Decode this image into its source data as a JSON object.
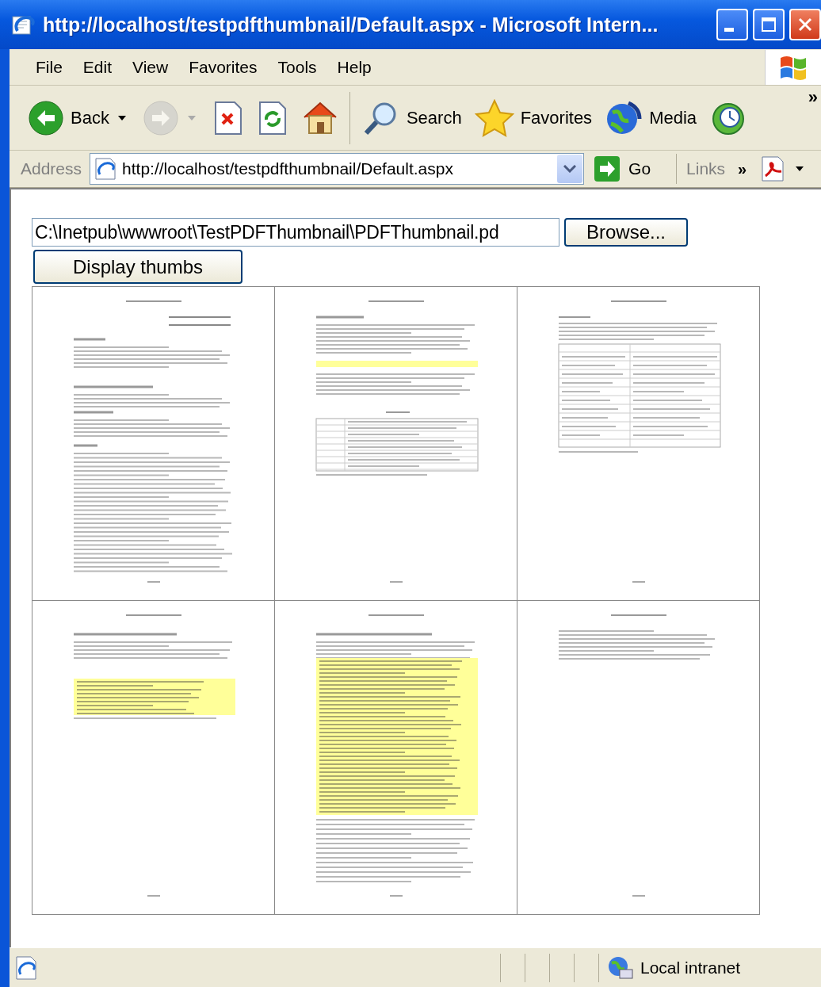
{
  "window": {
    "title": "http://localhost/testpdfthumbnail/Default.aspx - Microsoft Intern..."
  },
  "menu": [
    "File",
    "Edit",
    "View",
    "Favorites",
    "Tools",
    "Help"
  ],
  "toolbar": [
    {
      "kind": "back",
      "label": "Back",
      "dropdown": true,
      "disabled": false
    },
    {
      "kind": "forward",
      "dropdown": true,
      "disabled": true
    },
    {
      "kind": "stop",
      "dropdown": false,
      "disabled": false
    },
    {
      "kind": "refresh",
      "dropdown": false,
      "disabled": false
    },
    {
      "kind": "home",
      "dropdown": false,
      "disabled": false
    },
    {
      "kind": "separator"
    },
    {
      "kind": "search",
      "label": "Search",
      "dropdown": false,
      "disabled": false
    },
    {
      "kind": "favorites",
      "label": "Favorites",
      "dropdown": false,
      "disabled": false
    },
    {
      "kind": "media",
      "label": "Media",
      "dropdown": false,
      "disabled": false
    },
    {
      "kind": "history",
      "dropdown": false,
      "disabled": false
    }
  ],
  "toolbar_overflow": "»",
  "address_bar": {
    "label": "Address",
    "url": "http://localhost/testpdfthumbnail/Default.aspx",
    "go": "Go",
    "links": "Links",
    "links_overflow": "»"
  },
  "page": {
    "file_field": {
      "value": "C:\\Inetpub\\wwwroot\\TestPDFThumbnail\\PDFThumbnail.pd"
    },
    "browse_button": "Browse...",
    "display_button": "Display thumbs",
    "thumbnails": [
      {
        "kind": "text"
      },
      {
        "kind": "table"
      },
      {
        "kind": "form"
      },
      {
        "kind": "code"
      },
      {
        "kind": "listing"
      },
      {
        "kind": "short"
      }
    ]
  },
  "status_bar": {
    "zone": "Local intranet"
  }
}
